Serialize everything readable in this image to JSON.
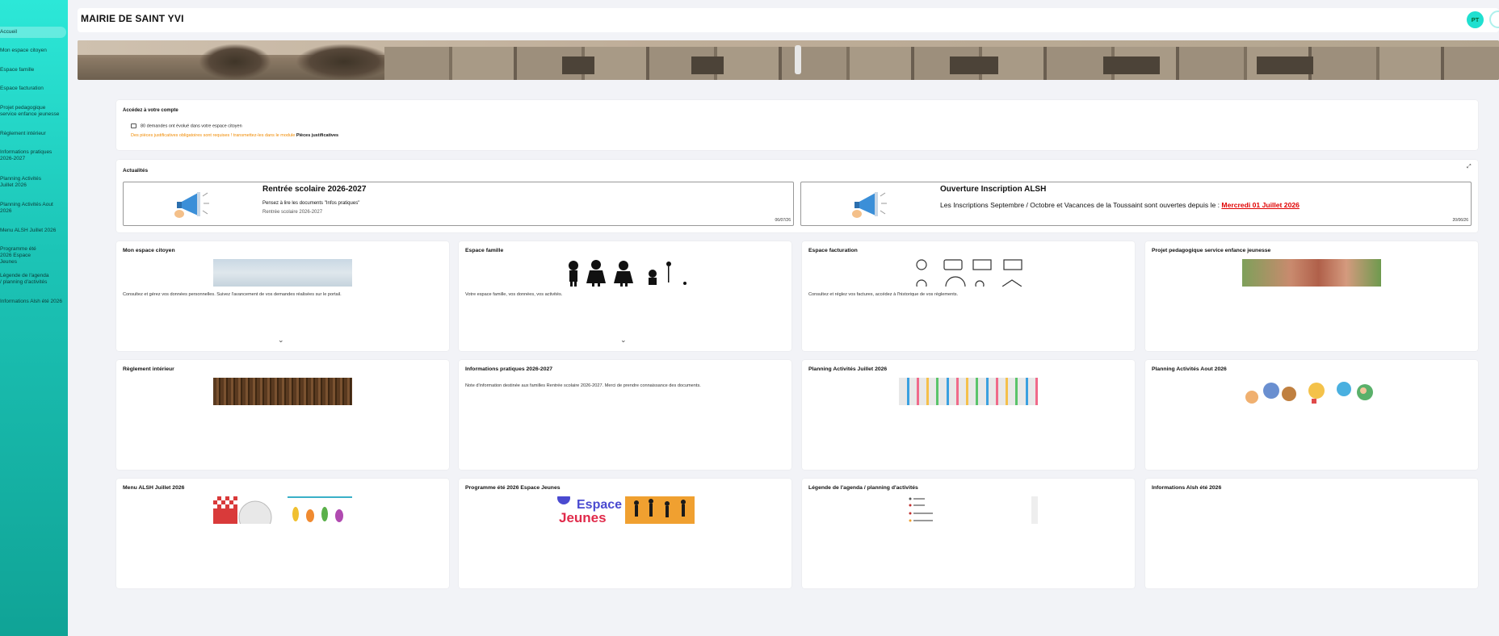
{
  "app": {
    "title": "MAIRIE DE SAINT YVI",
    "avatar_initials": "PT"
  },
  "sidebar": {
    "items": [
      {
        "label": "Accueil",
        "active": true
      },
      {
        "label": "Mon espace citoyen"
      },
      {
        "label": "Espace famille"
      },
      {
        "label": "Espace facturation"
      },
      {
        "label": "Projet pedagogique service enfance jeunesse"
      },
      {
        "label": "Règlement intérieur"
      },
      {
        "label": "Informations pratiques 2026-2027"
      },
      {
        "label": "Planning Activités Juillet 2026"
      },
      {
        "label": "Planning Activités Aout 2026"
      },
      {
        "label": "Menu ALSH Juillet 2026"
      },
      {
        "label": "Programme été 2026 Espace Jeunes"
      },
      {
        "label": "Légende de l'agenda / planning d'activités"
      },
      {
        "label": "Informations Alsh été 2026"
      }
    ]
  },
  "account": {
    "heading": "Accédez à votre compte",
    "requests_text": "80 demandes ont évolué dans votre espace citoyen",
    "documents_warning": "Des pièces justificatives obligatoires sont requises ! transmettez-les dans le module",
    "documents_link": "Pièces justificatives"
  },
  "news": {
    "heading": "Actualités",
    "items": [
      {
        "title": "Rentrée scolaire 2026-2027",
        "text": "Pensez à lire les documents \"Infos pratiques\"",
        "text2": "Rentrée scolaire 2026-2027",
        "date": "06/07/26"
      },
      {
        "title": "Ouverture Inscription ALSH",
        "text": "Les Inscriptions Septembre / Octobre et Vacances de la Toussaint sont ouvertes depuis le :",
        "link": "Mercredi 01 Juillet 2026",
        "date": "20/06/26"
      }
    ]
  },
  "tiles": [
    {
      "title": "Mon espace citoyen",
      "desc": "Consultez et gérez vos données personnelles. Suivez l'avancement de vos demandes réalisées sur le portail."
    },
    {
      "title": "Espace famille",
      "desc": "Votre espace famille, vos données, vos activités."
    },
    {
      "title": "Espace facturation",
      "desc": "Consultez et réglez vos factures, accédez à l'historique de vos règlements."
    },
    {
      "title": "Projet pedagogique service enfance jeunesse",
      "desc": ""
    },
    {
      "title": "Règlement intérieur",
      "desc": ""
    },
    {
      "title": "Informations pratiques 2026-2027",
      "desc": "Note d'information destinée aux familles Rentrée scolaire 2026-2027. Merci de prendre connaissance des documents."
    },
    {
      "title": "Planning Activités Juillet 2026",
      "desc": ""
    },
    {
      "title": "Planning Activités Aout 2026",
      "desc": ""
    },
    {
      "title": "Menu ALSH Juillet 2026",
      "desc": ""
    },
    {
      "title": "Programme été 2026 Espace Jeunes",
      "desc": ""
    },
    {
      "title": "Légende de l'agenda / planning d'activités",
      "desc": ""
    },
    {
      "title": "Informations Alsh été 2026",
      "desc": ""
    }
  ],
  "icons": {
    "expand": "expand-icon",
    "megaphone": "megaphone-icon",
    "chevron": "chevron-down-icon",
    "message": "message-icon"
  },
  "colors": {
    "accent": "#1fe0d0",
    "warning": "#f08a00",
    "alert": "#e00000"
  }
}
